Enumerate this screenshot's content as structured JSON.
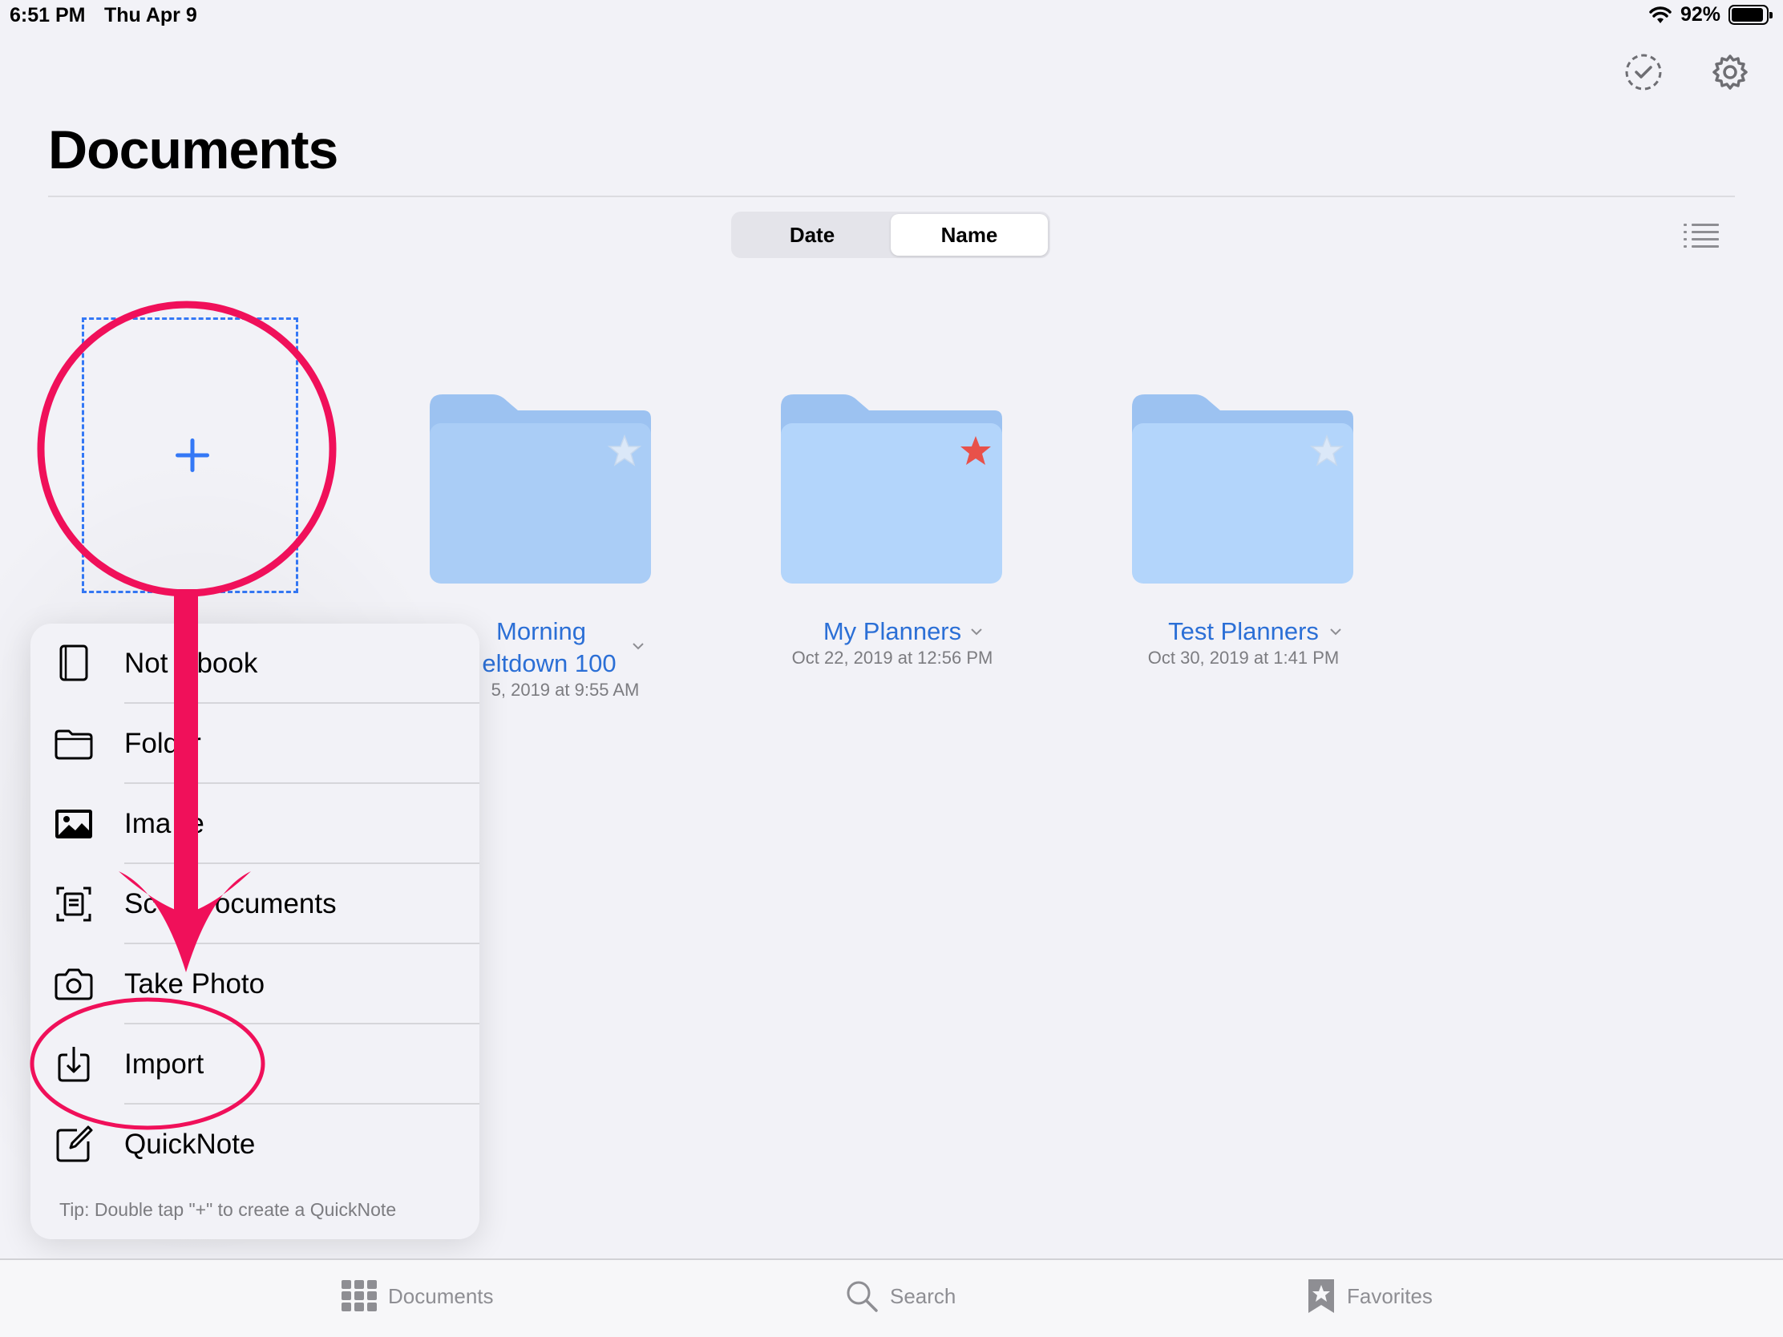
{
  "status_bar": {
    "time": "6:51 PM",
    "date": "Thu Apr 9",
    "battery": "92%",
    "battery_level": 0.92
  },
  "toolbar": {
    "select_icon": "checkmark-circle-dashed-icon",
    "settings_icon": "gear-icon"
  },
  "page": {
    "title": "Documents"
  },
  "sort": {
    "options": [
      "Date",
      "Name"
    ],
    "selected": "Name"
  },
  "view_toggle_icon": "list-icon",
  "add_tile_icon": "plus-icon",
  "folders": [
    {
      "name_line1": "Morning",
      "name_line2": "eltdown 100",
      "date": "5, 2019 at 9:55 AM",
      "favorite": false
    },
    {
      "name": "My Planners",
      "date": "Oct 22, 2019 at 12:56 PM",
      "favorite": true
    },
    {
      "name": "Test Planners",
      "date": "Oct 30, 2019 at 1:41 PM",
      "favorite": false
    }
  ],
  "colors": {
    "accent": "#2b6fd6",
    "folder_body": "#b3d5fb",
    "folder_tab": "#9cc2f1",
    "favorite_star": "#e8514a",
    "annotation": "#f0105a"
  },
  "menu": {
    "items": [
      {
        "label": "Not",
        "label_after": "book",
        "icon": "notebook-icon"
      },
      {
        "label": "Fold",
        "label_after": "r",
        "icon": "folder-icon"
      },
      {
        "label": "Ima",
        "label_after": "e",
        "icon": "image-icon"
      },
      {
        "label": "Sc",
        "label_after": "ocuments",
        "icon": "scan-document-icon"
      },
      {
        "label": "Take Photo",
        "label_after": "",
        "icon": "camera-icon"
      },
      {
        "label": "Import",
        "label_after": "",
        "icon": "import-icon"
      },
      {
        "label": "QuickNote",
        "label_after": "",
        "icon": "quicknote-icon"
      }
    ],
    "tip": "Tip: Double tap \"+\" to create a QuickNote"
  },
  "tab_bar": {
    "tabs": [
      {
        "label": "Documents",
        "icon": "grid-icon"
      },
      {
        "label": "Search",
        "icon": "search-icon"
      },
      {
        "label": "Favorites",
        "icon": "bookmark-star-icon"
      }
    ]
  }
}
